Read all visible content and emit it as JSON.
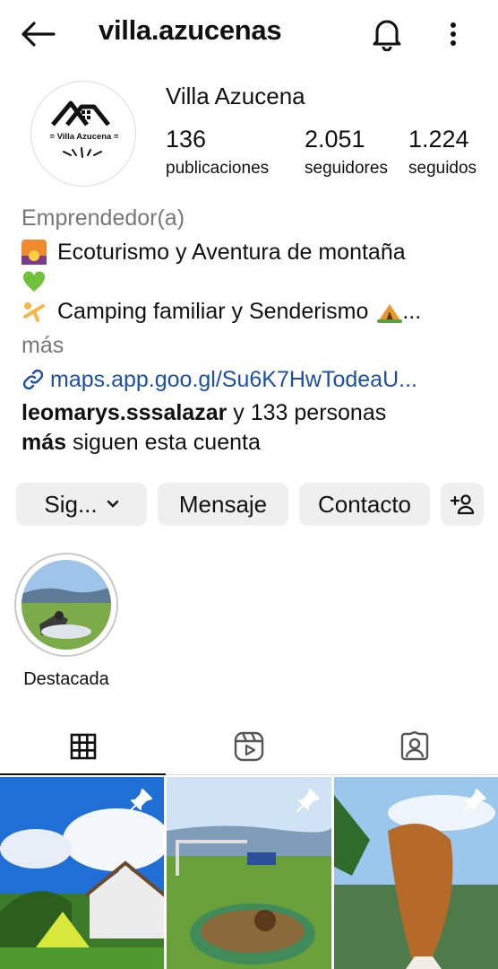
{
  "header": {
    "username": "villa.azucenas",
    "back_icon": "arrow-left-icon",
    "bell_icon": "bell-icon",
    "more_icon": "vertical-dots-icon"
  },
  "profile": {
    "display_name": "Villa Azucena",
    "avatar_text": "= Villa Azucena =",
    "stats": {
      "posts_count": "136",
      "posts_label": "publicaciones",
      "followers_count": "2.051",
      "followers_label": "seguidores",
      "following_count": "1.224",
      "following_label": "seguidos"
    }
  },
  "bio": {
    "category": "Emprendedor(a)",
    "line1": "Ecoturismo y Aventura de montaña",
    "line2": "Camping familiar y Senderismo",
    "line2_suffix": "...",
    "more": "más",
    "link": "maps.app.goo.gl/Su6K7HwTodeaU...",
    "followed_by_user": "leomarys.sssalazar",
    "followed_by_rest": " y 133 personas",
    "followed_by_more": "más",
    "followed_by_tail": " siguen esta cuenta"
  },
  "actions": {
    "follow_label": "Sig...",
    "message_label": "Mensaje",
    "contact_label": "Contacto"
  },
  "highlights": [
    {
      "label": "Destacada"
    }
  ],
  "tabs": {
    "grid_icon": "grid-icon",
    "reels_icon": "reels-icon",
    "tagged_icon": "tagged-icon"
  },
  "colors": {
    "link": "#1b4fa8",
    "button_bg": "#efefef",
    "muted": "#777777"
  }
}
